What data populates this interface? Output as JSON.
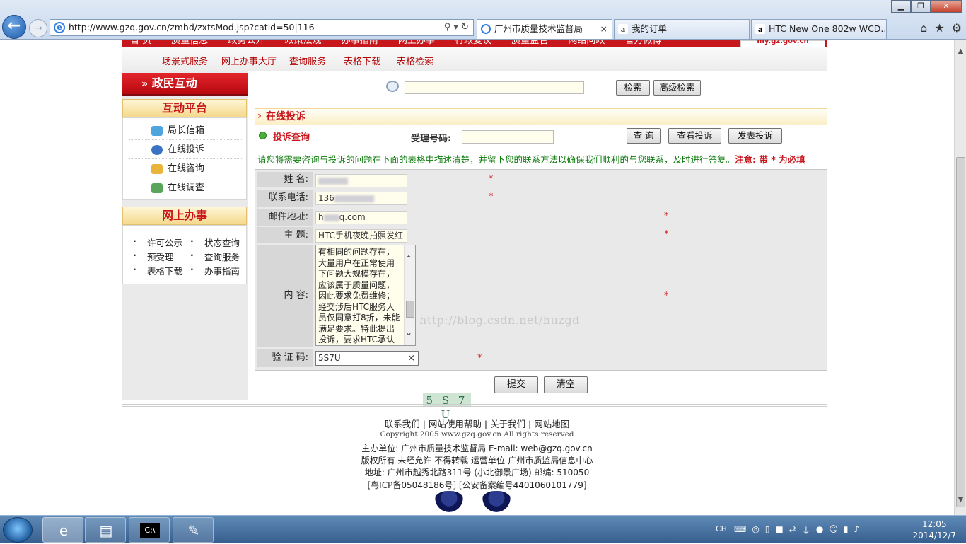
{
  "browser": {
    "url": "http://www.gzq.gov.cn/zmhd/zxtsMod.jsp?catid=50|116",
    "tabs": [
      {
        "title": "广州市质量技术监督局",
        "close": "×"
      },
      {
        "title": "我的订单"
      },
      {
        "title": "HTC New One 802w WCD..."
      }
    ]
  },
  "site": {
    "top_nav": [
      "首 页",
      "质量信息",
      "政务公开",
      "政策法规",
      "办事指南",
      "网上办事",
      "行政复议",
      "质量监管",
      "网络问政",
      "官方微博"
    ],
    "my_gz": "my.gz.gov.cn",
    "sub_nav": [
      "场景式服务",
      "网上办事大厅",
      "查询服务",
      "表格下载",
      "表格检索"
    ]
  },
  "left": {
    "title": "政民互动",
    "hd_title": "互动平台",
    "hd_items": [
      "局长信箱",
      "在线投诉",
      "在线咨询",
      "在线调查"
    ],
    "ws_title": "网上办事",
    "ws_items": [
      "许可公示",
      "状态查询",
      "预受理",
      "查询服务",
      "表格下载",
      "办事指南"
    ]
  },
  "search": {
    "button": "检索",
    "advanced": "高级检索"
  },
  "section": {
    "title": "在线投诉",
    "query_label": "投诉查询",
    "number_label": "受理号码:",
    "buttons": [
      "查 询",
      "查看投诉",
      "发表投诉"
    ],
    "notice": "请您将需要咨询与投诉的问题在下面的表格中描述清楚，并留下您的联系方法以确保我们顺利的与您联系，及时进行答复。",
    "notice_required": "注意: 带 * 为必填"
  },
  "form": {
    "name_label": "姓 名:",
    "phone_label": "联系电话:",
    "phone_value": "136",
    "email_label": "邮件地址:",
    "email_value_start": "h",
    "email_value_end": "q.com",
    "subject_label": "主 题:",
    "subject_value": "HTC手机夜晚拍照发红",
    "content_label": "内 容:",
    "content_value": "有相同的问题存在，大量用户在正常使用下问题大规模存在，应该属于质量问题，因此要求免费维修；经交涉后HTC服务人员仅同意打8折，未能满足要求。特此提出投诉，要求HTC承认质量问题并免费保修。",
    "captcha_label": "验 证 码:",
    "captcha_value": "5S7U",
    "captcha_clear": "×",
    "captcha_image": "5 S 7 U",
    "required_mark": "*",
    "submit": "提交",
    "reset": "清空",
    "watermark": "http://blog.csdn.net/huzgd"
  },
  "footer": {
    "links": "联系我们 | 网站使用帮助 | 关于我们 | 网站地图",
    "copyright": "Copyright 2005 www.gzq.gov.cn All rights reserved",
    "host": "主办单位: 广州市质量技术监督局 E-mail: web@gzq.gov.cn",
    "rights": "版权所有 未经允许 不得转载 运营单位-广州市质监局信息中心",
    "address": "地址: 广州市越秀北路311号 (小北御景广场) 邮编: 510050",
    "icp": "[粤ICP备05048186号] [公安备案编号4401060101779]"
  },
  "taskbar": {
    "lang": "CH",
    "time": "12:05",
    "date": "2014/12/7"
  }
}
